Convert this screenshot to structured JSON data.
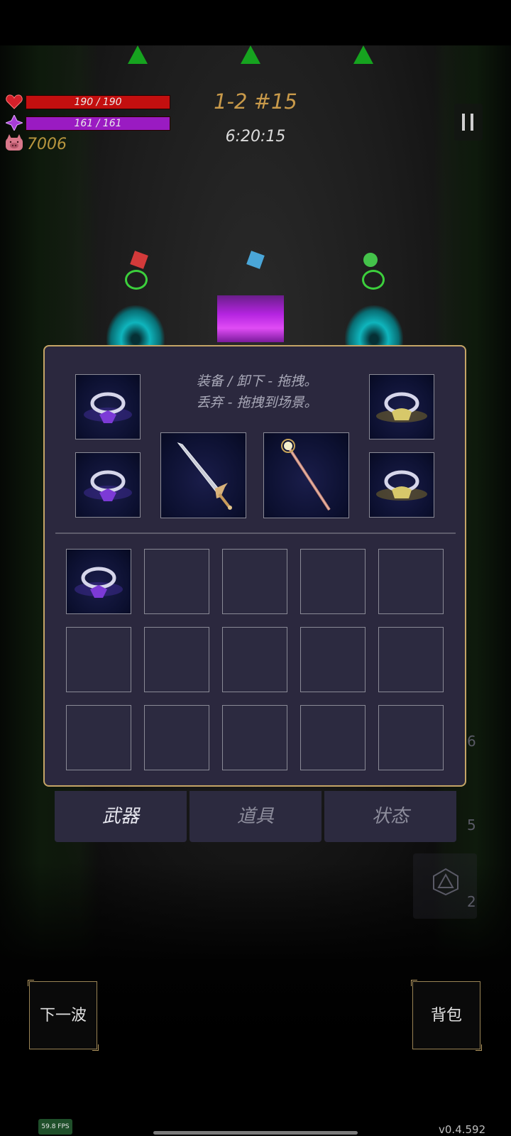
{
  "hud": {
    "hp_text": "190 / 190",
    "hp_fraction": 1.0,
    "mp_text": "161 / 161",
    "mp_fraction": 1.0,
    "gold": "7006",
    "stage": "1-2 #15",
    "timer": "6:20:15"
  },
  "inventory": {
    "hint_line1": "装备 / 卸下 - 拖拽。",
    "hint_line2": "丢弃 - 拖拽到场景。",
    "equipped": {
      "left_ring_top": "purple-ring-icon",
      "left_ring_bottom": "purple-ring-icon",
      "weapon_1": "sword-icon",
      "weapon_2": "staff-icon",
      "right_ring_top": "gold-ring-icon",
      "right_ring_bottom": "gold-ring-icon"
    },
    "bag_slots": [
      "purple-ring-icon",
      "",
      "",
      "",
      "",
      "",
      "",
      "",
      "",
      "",
      "",
      "",
      "",
      "",
      ""
    ],
    "tabs": [
      "武器",
      "道具",
      "状态"
    ],
    "active_tab": "武器"
  },
  "side_counts": [
    "6",
    "5",
    "2"
  ],
  "buttons": {
    "next_wave": "下一波",
    "backpack": "背包"
  },
  "footer": {
    "fps": "59.8 FPS",
    "version": "v0.4.592"
  },
  "colors": {
    "hp": "#c30f0f",
    "mp": "#9a1bc2",
    "panel_border": "#c5a566",
    "panel_bg": "#2b283e"
  }
}
